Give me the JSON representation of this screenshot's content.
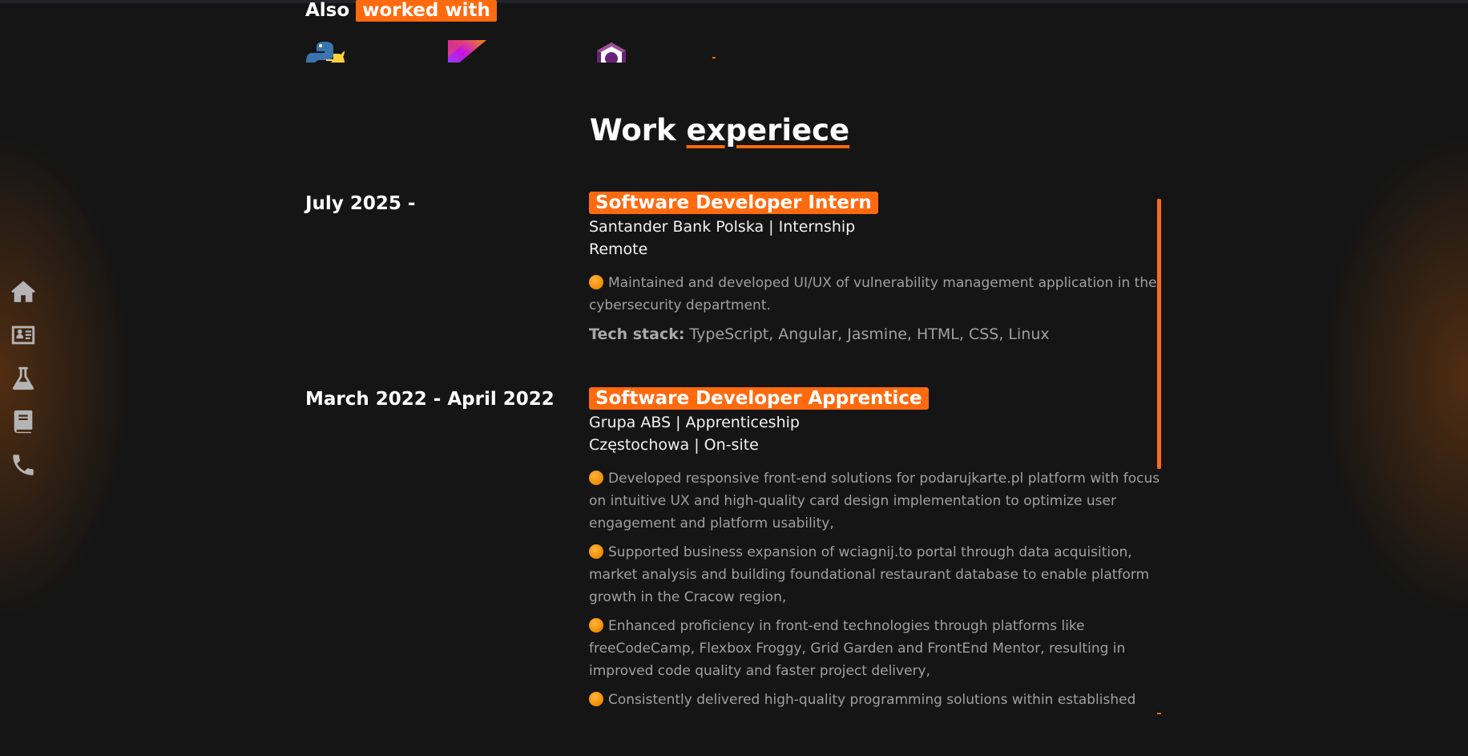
{
  "also_worked_with": {
    "prefix": "Also",
    "highlight": "worked with",
    "logos": [
      "python-logo",
      "kotlin-logo",
      "csharp-logo"
    ]
  },
  "nav": {
    "items": [
      {
        "icon": "home-icon"
      },
      {
        "icon": "id-card-icon"
      },
      {
        "icon": "flask-icon"
      },
      {
        "icon": "book-icon"
      },
      {
        "icon": "phone-icon"
      }
    ]
  },
  "section": {
    "title_part1": "Work",
    "title_part2": "experiece"
  },
  "jobs": [
    {
      "date": "July 2025 -",
      "title": "Software Developer Intern",
      "company": "Santander Bank Polska | Internship",
      "location": "Remote",
      "bullets": [
        "Maintained and developed UI/UX of vulnerability management application in the cybersecurity department."
      ],
      "tech_label": "Tech stack:",
      "tech_value": "TypeScript, Angular, Jasmine, HTML, CSS, Linux"
    },
    {
      "date": "March 2022 - April 2022",
      "title": "Software Developer Apprentice",
      "company": "Grupa ABS | Apprenticeship",
      "location": "Częstochowa | On-site",
      "bullets": [
        "Developed responsive front-end solutions for podarujkarte.pl platform with focus on intuitive UX and high-quality card design implementation to optimize user engagement and platform usability,",
        "Supported business expansion of wciagnij.to portal through data acquisition, market analysis and building foundational restaurant database to enable platform growth in the Cracow region,",
        "Enhanced proficiency in front-end technologies through platforms like freeCodeCamp, Flexbox Froggy, Grid Garden and FrontEnd Mentor, resulting in improved code quality and faster project delivery,",
        "Consistently delivered high-quality programming solutions within established"
      ]
    }
  ],
  "colors": {
    "accent": "#ff6a0f",
    "background": "#151515",
    "text_muted": "#a0a0a0"
  }
}
